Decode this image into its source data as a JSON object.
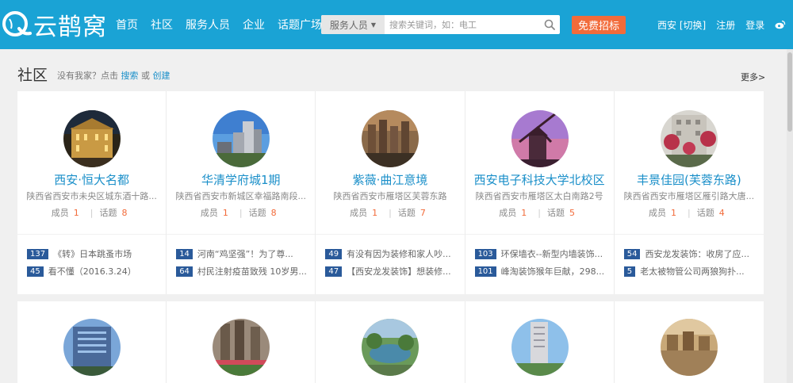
{
  "header": {
    "logo_text": "云鹊窝",
    "nav": [
      "首页",
      "社区",
      "服务人员",
      "企业",
      "话题广场"
    ],
    "search": {
      "category": "服务人员",
      "placeholder": "搜索关键词，如：电工"
    },
    "post_button": "免费招标",
    "city": "西安 [切换]",
    "register": "注册",
    "login": "登录"
  },
  "section": {
    "title": "社区",
    "prompt": "没有我家？点击",
    "search_link": "搜索",
    "or": "或",
    "create_link": "创建",
    "more": "更多>"
  },
  "labels": {
    "members": "成员",
    "topics": "话题"
  },
  "communities": [
    {
      "name": "西安·恒大名都",
      "address": "陕西省西安市未央区城东酒十路...",
      "members": "1",
      "topics": "8",
      "posts": [
        {
          "count": "137",
          "title": "《转》日本跳蚤市场"
        },
        {
          "count": "45",
          "title": "看不懂（2016.3.24）"
        }
      ]
    },
    {
      "name": "华清学府城1期",
      "address": "陕西省西安市新城区幸福路南段...",
      "members": "1",
      "topics": "8",
      "posts": [
        {
          "count": "14",
          "title": "河南“鸡坚强”！为了尊..."
        },
        {
          "count": "64",
          "title": "村民注射疫苗致残 10岁男..."
        }
      ]
    },
    {
      "name": "紫薇·曲江意境",
      "address": "陕西省西安市雁塔区芙蓉东路",
      "members": "1",
      "topics": "7",
      "posts": [
        {
          "count": "49",
          "title": "有没有因为装修和家人吵..."
        },
        {
          "count": "47",
          "title": "【西安龙发装饰】想装修..."
        }
      ]
    },
    {
      "name": "西安电子科技大学北校区",
      "address": "陕西省西安市雁塔区太白南路2号",
      "members": "1",
      "topics": "5",
      "posts": [
        {
          "count": "103",
          "title": "环保墙衣--新型内墙装饰..."
        },
        {
          "count": "101",
          "title": "峰淘装饰猴年巨献，298..."
        }
      ]
    },
    {
      "name": "丰景佳园(芙蓉东路)",
      "address": "陕西省西安市雁塔区雁引路大唐...",
      "members": "1",
      "topics": "4",
      "posts": [
        {
          "count": "54",
          "title": "西安龙发装饰：收房了应..."
        },
        {
          "count": "5",
          "title": "老太被物管公司两狼狗扑..."
        }
      ]
    }
  ],
  "colors": {
    "header": "#1aa3d5",
    "link": "#1a8fc9",
    "accent": "#f26b3a",
    "badge": "#2a5a9a"
  }
}
